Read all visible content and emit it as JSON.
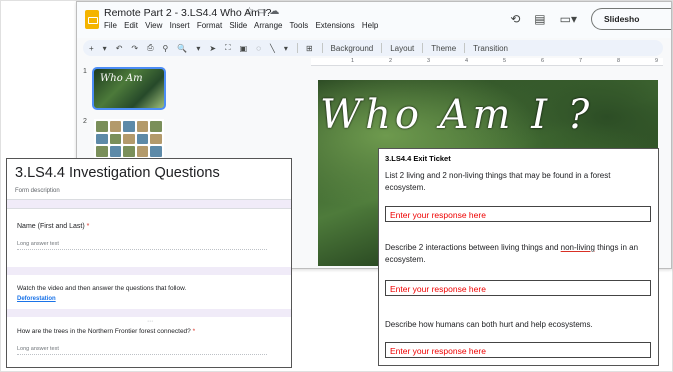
{
  "slides_window": {
    "doc_title": "Remote Part 2 - 3.LS4.4 Who Am I?",
    "title_icons": [
      "star-icon",
      "folder-move-icon",
      "cloud-status-icon"
    ],
    "menu": [
      "File",
      "Edit",
      "View",
      "Insert",
      "Format",
      "Slide",
      "Arrange",
      "Tools",
      "Extensions",
      "Help"
    ],
    "header_icons": [
      "history-icon",
      "comments-icon",
      "meet-icon"
    ],
    "slideshow_label": "Slidesho",
    "toolbar": {
      "icons": [
        "+",
        "▾",
        "↶",
        "↷",
        "⎙",
        "⚲",
        "🔍",
        "▾",
        "➤",
        "⛶",
        "▣",
        "◌",
        "╲",
        "▾",
        "⊞"
      ],
      "buttons": [
        "Background",
        "Layout",
        "Theme",
        "Transition"
      ]
    },
    "thumbnails": [
      {
        "number": "1",
        "title": "Who Am"
      },
      {
        "number": "2"
      }
    ],
    "ruler_marks": [
      "1",
      "2",
      "3",
      "4",
      "5",
      "6",
      "7",
      "8",
      "9"
    ],
    "slide_title": "Who Am I ?"
  },
  "form": {
    "title": "3.LS4.4 Investigation Questions",
    "description": "Form description",
    "q1": {
      "label": "Name (First and Last)",
      "required": "*",
      "placeholder": "Long answer text"
    },
    "video": {
      "label": "Watch the video and then answer the questions that follow.",
      "link": "Deforestation"
    },
    "q2": {
      "label": "How are the trees in the Northern Frontier forest connected?",
      "required": "*",
      "placeholder": "Long answer text"
    }
  },
  "exit_ticket": {
    "title": "3.LS4.4 Exit Ticket",
    "questions": [
      {
        "text": "List 2 living and 2 non-living things that may be found in a forest ecosystem.",
        "response": "Enter your response here"
      },
      {
        "text_before": "Describe 2 interactions between living things and ",
        "text_underlined": "non-living",
        "text_after": " things in an ecosystem.",
        "response": "Enter your response here"
      },
      {
        "text": "Describe how humans can both hurt and help ecosystems.",
        "response": "Enter your response here"
      }
    ]
  }
}
